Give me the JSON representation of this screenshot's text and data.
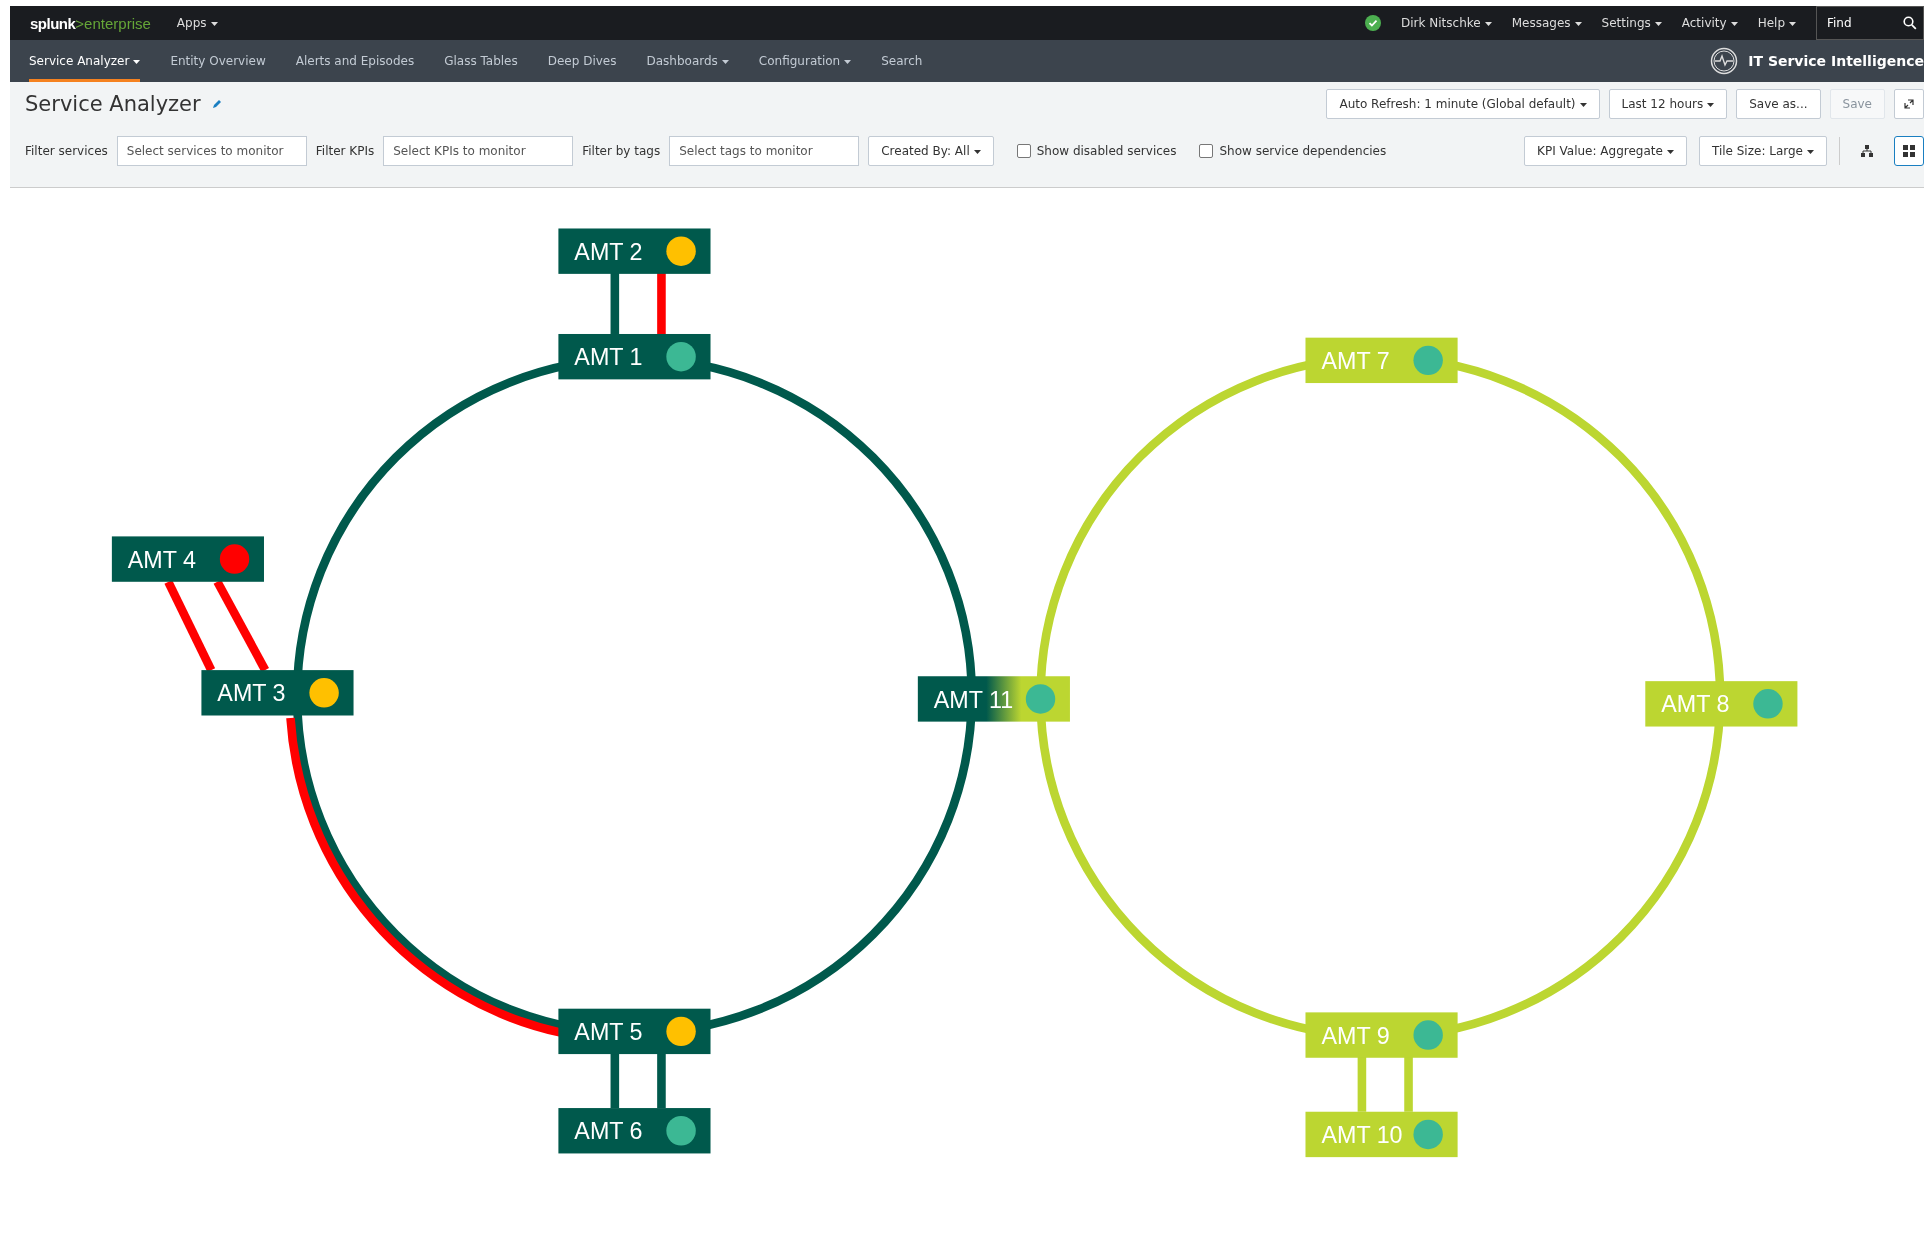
{
  "brand": {
    "prefix": "splunk",
    "product": ">enterprise"
  },
  "app_menu": {
    "label": "Apps",
    "dropdown": true
  },
  "status_ok": true,
  "user_menus": [
    {
      "label": "Dirk Nitschke",
      "dropdown": true
    },
    {
      "label": "Messages",
      "dropdown": true
    },
    {
      "label": "Settings",
      "dropdown": true
    },
    {
      "label": "Activity",
      "dropdown": true
    },
    {
      "label": "Help",
      "dropdown": true
    }
  ],
  "find": {
    "placeholder": "Find"
  },
  "nav": [
    {
      "label": "Service Analyzer",
      "dropdown": true,
      "selected": true
    },
    {
      "label": "Entity Overview",
      "dropdown": false,
      "selected": false
    },
    {
      "label": "Alerts and Episodes",
      "dropdown": false,
      "selected": false
    },
    {
      "label": "Glass Tables",
      "dropdown": false,
      "selected": false
    },
    {
      "label": "Deep Dives",
      "dropdown": false,
      "selected": false
    },
    {
      "label": "Dashboards",
      "dropdown": true,
      "selected": false
    },
    {
      "label": "Configuration",
      "dropdown": true,
      "selected": false
    },
    {
      "label": "Search",
      "dropdown": false,
      "selected": false
    }
  ],
  "app_title": "IT Service Intelligence",
  "page_title": "Service Analyzer",
  "header_buttons": [
    {
      "label": "Auto Refresh: 1 minute (Global default)",
      "dropdown": true,
      "disabled": false
    },
    {
      "label": "Last 12 hours",
      "dropdown": true,
      "disabled": false
    },
    {
      "label": "Save as...",
      "dropdown": false,
      "disabled": false
    },
    {
      "label": "Save",
      "dropdown": false,
      "disabled": true
    }
  ],
  "filters": [
    {
      "label": "Filter services",
      "placeholder": "Select services to monitor"
    },
    {
      "label": "Filter KPIs",
      "placeholder": "Select KPIs to monitor"
    },
    {
      "label": "Filter by tags",
      "placeholder": "Select tags to monitor"
    }
  ],
  "created_by": {
    "label": "Created By: All",
    "dropdown": true
  },
  "checkboxes": [
    {
      "label": "Show disabled services",
      "checked": false
    },
    {
      "label": "Show service dependencies",
      "checked": false
    }
  ],
  "view_dropdowns": [
    {
      "label": "KPI Value: Aggregate",
      "dropdown": true
    },
    {
      "label": "Tile Size: Large",
      "dropdown": true
    }
  ],
  "view_modes": [
    {
      "selected": false
    },
    {
      "selected": true
    }
  ],
  "rings": [
    {
      "color": "#00594c"
    },
    {
      "color": "#bcd631"
    }
  ],
  "nodes": [
    {
      "label": "AMT 2",
      "kind": "dark",
      "color": "#ffc000"
    },
    {
      "label": "AMT 1",
      "kind": "dark",
      "color": "#3cb894"
    },
    {
      "label": "AMT 4",
      "kind": "dark",
      "color": "#ff0000"
    },
    {
      "label": "AMT 3",
      "kind": "dark",
      "color": "#ffc000"
    },
    {
      "label": "AMT 11",
      "kind": "bridge",
      "color": "#3cb894"
    },
    {
      "label": "AMT 5",
      "kind": "dark",
      "color": "#ffc000"
    },
    {
      "label": "AMT 6",
      "kind": "dark",
      "color": "#3cb894"
    },
    {
      "label": "AMT 7",
      "kind": "lime",
      "color": "#3cb894"
    },
    {
      "label": "AMT 8",
      "kind": "lime",
      "color": "#3cb894"
    },
    {
      "label": "AMT 9",
      "kind": "lime",
      "color": "#3cb894"
    },
    {
      "label": "AMT 10",
      "kind": "lime",
      "color": "#3cb894"
    }
  ],
  "links": [
    {
      "color": "#00594c"
    },
    {
      "color": "#ff0000"
    },
    {
      "color": "#ff0000"
    },
    {
      "color": "#ff0000"
    },
    {
      "color": "#ff0000"
    },
    {
      "color": "#00594c"
    },
    {
      "color": "#00594c"
    },
    {
      "color": "#bcd631"
    },
    {
      "color": "#bcd631"
    }
  ]
}
